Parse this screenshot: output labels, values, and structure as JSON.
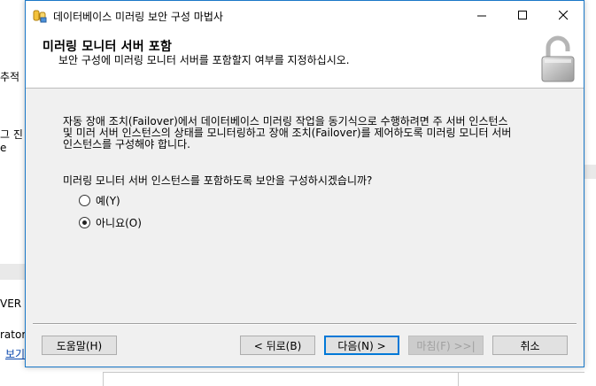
{
  "background": {
    "left_fragments": [
      "추적",
      "그 진",
      "e",
      "VER",
      "rator",
      "보기"
    ]
  },
  "window": {
    "title": "데이터베이스 미러링 보안 구성 마법사",
    "minimize_glyph": "—",
    "maximize_glyph": "☐",
    "close_glyph": "✕"
  },
  "header": {
    "title": "미러링 모니터 서버 포함",
    "subtitle": "보안 구성에 미러링 모니터 서버를 포함할지 여부를 지정하십시오."
  },
  "body": {
    "description_line1": "자동 장애 조치(Failover)에서 데이터베이스 미러링 작업을 동기식으로 수행하려면 주 서버 인스턴스",
    "description_line2": "및 미러 서버 인스턴스의 상태를 모니터링하고 장애 조치(Failover)를 제어하도록 미러링 모니터 서버",
    "description_line3": "인스턴스를 구성해야 합니다.",
    "question": "미러링 모니터 서버 인스턴스를 포함하도록 보안을 구성하시겠습니까?",
    "options": [
      {
        "label": "예(Y)",
        "selected": false
      },
      {
        "label": "아니요(O)",
        "selected": true
      }
    ]
  },
  "buttons": {
    "help": "도움말(H)",
    "back": "< 뒤로(B)",
    "next": "다음(N) >",
    "finish": "마침(F) >>|",
    "cancel": "취소"
  }
}
